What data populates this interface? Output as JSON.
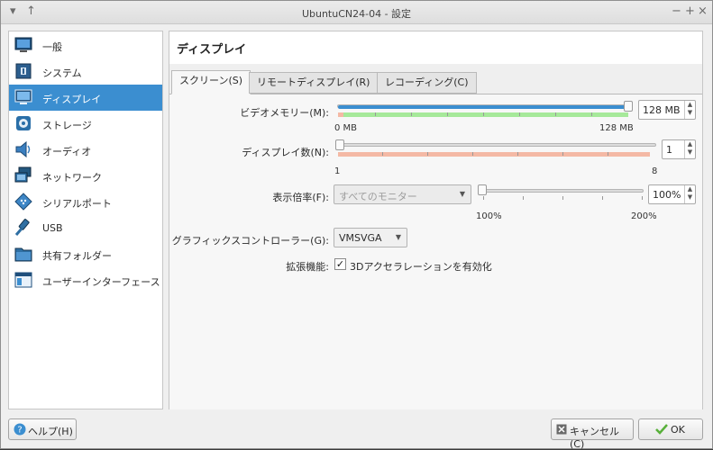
{
  "window": {
    "title": "UbuntuCN24-04 - 設定",
    "controls": [
      "−",
      "+",
      "×"
    ]
  },
  "sidebar": {
    "items": [
      {
        "label": "一般",
        "icon": "monitor-general-icon"
      },
      {
        "label": "システム",
        "icon": "chip-icon"
      },
      {
        "label": "ディスプレイ",
        "icon": "display-icon",
        "selected": true
      },
      {
        "label": "ストレージ",
        "icon": "storage-disc-icon"
      },
      {
        "label": "オーディオ",
        "icon": "speaker-icon"
      },
      {
        "label": "ネットワーク",
        "icon": "network-icon"
      },
      {
        "label": "シリアルポート",
        "icon": "serial-port-icon"
      },
      {
        "label": "USB",
        "icon": "usb-icon"
      },
      {
        "label": "共有フォルダー",
        "icon": "folder-icon"
      },
      {
        "label": "ユーザーインターフェース",
        "icon": "ui-window-icon"
      }
    ]
  },
  "content": {
    "title": "ディスプレイ",
    "tabs": [
      {
        "label": "スクリーン(S)",
        "active": true
      },
      {
        "label": "リモートディスプレイ(R)",
        "active": false
      },
      {
        "label": "レコーディング(C)",
        "active": false
      }
    ],
    "video_memory": {
      "label": "ビデオメモリー(M):",
      "value": "128 MB",
      "min_label": "0 MB",
      "max_label": "128 MB",
      "fraction": 1.0
    },
    "monitor_count": {
      "label": "ディスプレイ数(N):",
      "value": "1",
      "min_label": "1",
      "max_label": "8",
      "fraction": 0.0
    },
    "scale_factor": {
      "label": "表示倍率(F):",
      "monitor_select": "すべてのモニター",
      "value": "100%",
      "min_label": "100%",
      "max_label": "200%",
      "fraction": 0.0
    },
    "graphics_controller": {
      "label": "グラフィックスコントローラー(G):",
      "value": "VMSVGA"
    },
    "acceleration": {
      "label": "拡張機能:",
      "checkbox_label": "3Dアクセラレーションを有効化",
      "checked": true
    }
  },
  "footer": {
    "help_label": "ヘルプ(H)",
    "cancel_label": "キャンセル(C)",
    "ok_label": "OK"
  },
  "colors": {
    "selection": "#3b8ed0",
    "slider_green": "#a6e99a",
    "slider_red": "#f4b9a5"
  }
}
